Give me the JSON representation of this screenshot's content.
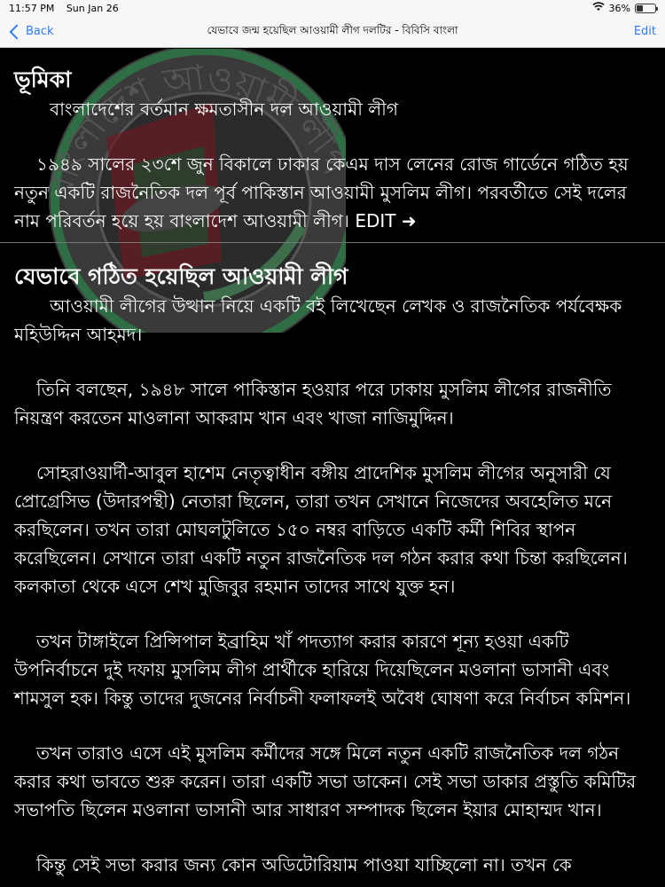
{
  "status_bar": {
    "time": "11:57 PM",
    "date": "Sun Jan 26",
    "battery": "36%",
    "battery_level": 0.36
  },
  "nav": {
    "back_label": "Back",
    "title": "যেভাবে জন্ম হয়েছিল আওয়ামী লীগ দলটির - বিবিসি বাংলা",
    "edit_label": "Edit"
  },
  "emblem": {
    "text": "বাংলাদেশ আওয়ামী লীগ",
    "colors": {
      "ring": "#1a8d3b",
      "red": "#c8102e",
      "green": "#006a4e"
    }
  },
  "article": {
    "section1_heading": "ভূমিকা",
    "section1_p1": "বাংলাদেশের বর্তমান ক্ষমতাসীন দল আওয়ামী লীগ",
    "section1_p2": "১৯৪৯ সালের ২৩শে জুন বিকালে ঢাকার কেএম দাস লেনের রোজ গার্ডেনে গঠিত হয় নতুন একটি রাজনৈতিক দল পূর্ব পাকিস্তান আওয়ামী মুসলিম লীগ। পরবর্তীতে সেই দলের নাম পরিবর্তন হয়ে হয় বাংলাদেশ আওয়ামী লীগ।",
    "edit_link": "EDIT ➜",
    "section2_heading": "যেভাবে গঠিত হয়েছিল আওয়ামী লীগ",
    "paragraphs": [
      "আওয়ামী লীগের উত্থান নিয়ে একটি বই লিখেছেন লেখক ও রাজনৈতিক পর্যবেক্ষক মহিউদ্দিন আহমদ।",
      "তিনি বলছেন, ১৯৪৮ সালে পাকিস্তান হওয়ার পরে ঢাকায় মুসলিম লীগের রাজনীতি নিয়ন্ত্রণ করতেন মাওলানা আকরাম খান এবং খাজা নাজিমুদ্দিন।",
      "সোহরাওয়ার্দী-আবুল হাশেম নেতৃত্বাধীন বঙ্গীয় প্রাদেশিক মুসলিম লীগের অনুসারী যে প্রোগ্রেসিভ (উদারপন্থী) নেতারা ছিলেন, তারা তখন সেখানে নিজেদের অবহেলিত মনে করছিলেন। তখন তারা মোঘলটুলিতে ১৫০ নম্বর বাড়িতে একটি কর্মী শিবির স্থাপন করেছিলেন। সেখানে তারা একটি নতুন রাজনৈতিক দল গঠন করার কথা চিন্তা করছিলেন। কলকাতা থেকে এসে শেখ মুজিবুর রহমান তাদের সাথে যুক্ত হন।",
      "তখন টাঙ্গাইলে প্রিন্সিপাল ইব্রাহিম খাঁ পদত্যাগ করার কারণে শূন্য হওয়া একটি উপনির্বাচনে দুই দফায় মুসলিম লীগ প্রার্থীকে হারিয়ে দিয়েছিলেন মওলানা ভাসানী এবং শামসুল হক। কিন্তু তাদের দুজনের নির্বাচনী ফলাফলই অবৈধ ঘোষণা করে নির্বাচন কমিশন।",
      "তখন তারাও এসে এই মুসলিম কর্মীদের সঙ্গে মিলে নতুন একটি রাজনৈতিক দল গঠন করার কথা ভাবতে শুরু করেন। তারা একটি সভা ডাকেন। সেই সভা ডাকার প্রস্তুতি কমিটির সভাপতি ছিলেন মওলানা ভাসানী আর সাধারণ সম্পাদক ছিলেন ইয়ার মোহাম্মদ খান।",
      "কিন্তু সেই সভা করার জন্য কোন অডিটোরিয়াম পাওয়া যাচ্ছিলো না। তখন কে"
    ]
  }
}
